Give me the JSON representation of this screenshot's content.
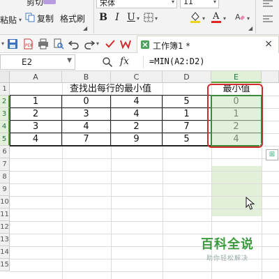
{
  "ribbon": {
    "cut_label": "剪切",
    "paste_label": "粘贴",
    "copy_label": "复制",
    "format_painter_label": "格式刷",
    "font_name": "宋体",
    "font_size": "11",
    "bold_label": "B",
    "italic_label": "I",
    "underline_label": "U"
  },
  "toolbar": {
    "doc_tab_title": "工作簿1 *",
    "close_label": "×"
  },
  "formula_bar": {
    "cell_ref": "E2",
    "fx_label": "fx",
    "formula": "=MIN(A2:D2)"
  },
  "sheet": {
    "columns": [
      "A",
      "B",
      "C",
      "D",
      "E"
    ],
    "selected_column": "E",
    "row_numbers": [
      "1",
      "2",
      "3",
      "4",
      "5",
      "6",
      "7",
      "8",
      "9",
      "10",
      "11",
      "12",
      "13",
      "14",
      "15"
    ],
    "header_title": "查找出每行的最小值",
    "header_min": "最小值",
    "rows": [
      {
        "a": "1",
        "b": "0",
        "c": "4",
        "d": "5",
        "e": "0"
      },
      {
        "a": "2",
        "b": "3",
        "c": "4",
        "d": "1",
        "e": "1"
      },
      {
        "a": "3",
        "b": "4",
        "c": "2",
        "d": "7",
        "e": "2"
      },
      {
        "a": "4",
        "b": "7",
        "c": "9",
        "d": "5",
        "e": "4"
      }
    ]
  },
  "watermark": {
    "title": "百科全说",
    "subtitle": "助你轻松解决"
  },
  "colors": {
    "accent_green": "#3d8a3d",
    "highlight_red": "#d22b2b",
    "selection_fill": "#e2efd9"
  }
}
